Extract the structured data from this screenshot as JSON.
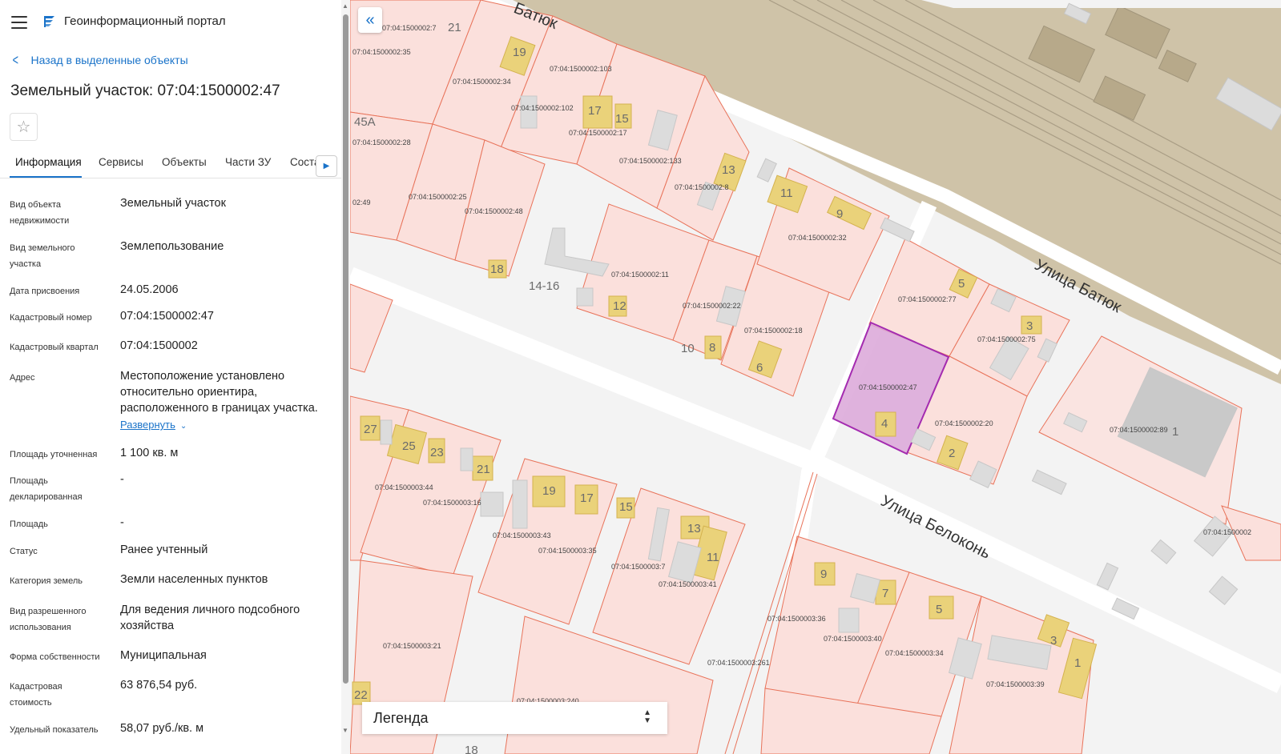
{
  "app": {
    "title": "Геоинформационный портал"
  },
  "nav": {
    "back_label": "Назад в выделенные объекты"
  },
  "object": {
    "title": "Земельный участок: 07:04:1500002:47"
  },
  "tabs": [
    {
      "label": "Информация",
      "active": true
    },
    {
      "label": "Сервисы",
      "active": false
    },
    {
      "label": "Объекты",
      "active": false
    },
    {
      "label": "Части ЗУ",
      "active": false
    },
    {
      "label": "Соста",
      "active": false
    }
  ],
  "fields": [
    {
      "label": "Вид объекта недвижимости",
      "value": "Земельный участок"
    },
    {
      "label": "Вид земельного участка",
      "value": "Землепользование"
    },
    {
      "label": "Дата присвоения",
      "value": "24.05.2006"
    },
    {
      "label": "Кадастровый номер",
      "value": "07:04:1500002:47"
    },
    {
      "label": "Кадастровый квартал",
      "value": "07:04:1500002"
    },
    {
      "label": "Адрес",
      "value": "Местоположение установлено относительно ориентира, расположенного в границах участка."
    },
    {
      "label": "Площадь уточненная",
      "value": "1 100 кв. м"
    },
    {
      "label": "Площадь декларированная",
      "value": "-"
    },
    {
      "label": "Площадь",
      "value": "-"
    },
    {
      "label": "Статус",
      "value": "Ранее учтенный"
    },
    {
      "label": "Категория земель",
      "value": "Земли населенных пунктов"
    },
    {
      "label": "Вид разрешенного использования",
      "value": "Для ведения личного подсобного хозяйства"
    },
    {
      "label": "Форма собственности",
      "value": "Муниципальная"
    },
    {
      "label": "Кадастровая стоимость",
      "value": "63 876,54 руб."
    },
    {
      "label": "Удельный показатель",
      "value": "58,07 руб./кв. м"
    }
  ],
  "address_expand_label": "Развернуть",
  "legend": {
    "label": "Легенда"
  },
  "map": {
    "street_labels": [
      "Батюк",
      "Улица Батюк",
      "Улица Белоконь"
    ],
    "parcel_labels": [
      "07:04:1500002:7",
      "07:04:1500002:35",
      "07:04:1500002:34",
      "07:04:1500002:103",
      "07:04:1500002:102",
      "07:04:1500002:17",
      "07:04:1500002:28",
      "07:04:1500002:133",
      "07:04:1500002:8",
      "07:04:1500002:25",
      "07:04:1500002:48",
      "02:49",
      "07:04:1500002:32",
      "07:04:1500002:11",
      "07:04:1500002:22",
      "07:04:1500002:18",
      "07:04:1500002:77",
      "07:04:1500002:75",
      "07:04:1500002:47",
      "07:04:1500002:20",
      "07:04:1500002:89",
      "07:04:1500003:44",
      "07:04:1500003:16",
      "07:04:1500003:43",
      "07:04:1500003:35",
      "07:04:1500003:7",
      "07:04:1500003:41",
      "07:04:1500003:36",
      "07:04:1500003:40",
      "07:04:1500003:34",
      "07:04:1500003:39",
      "07:04:1500003:261",
      "07:04:1500003:21",
      "07:04:1500003:240",
      "07:04:1500002"
    ],
    "house_numbers": [
      "21",
      "19",
      "17",
      "15",
      "45А",
      "13",
      "11",
      "9",
      "18",
      "14-16",
      "12",
      "10",
      "8",
      "6",
      "5",
      "3",
      "4",
      "2",
      "1",
      "27",
      "25",
      "23",
      "21",
      "19",
      "17",
      "15",
      "13",
      "11",
      "9",
      "7",
      "5",
      "3",
      "1",
      "22",
      "18"
    ]
  },
  "colors": {
    "accent": "#1a73c9",
    "parcel_fill": "#fbe0dc",
    "parcel_stroke": "#e8735a",
    "selected_fill": "#dba6d8",
    "selected_stroke": "#a42bb0",
    "building": "#ead27a",
    "railway": "#cfc3a8"
  }
}
